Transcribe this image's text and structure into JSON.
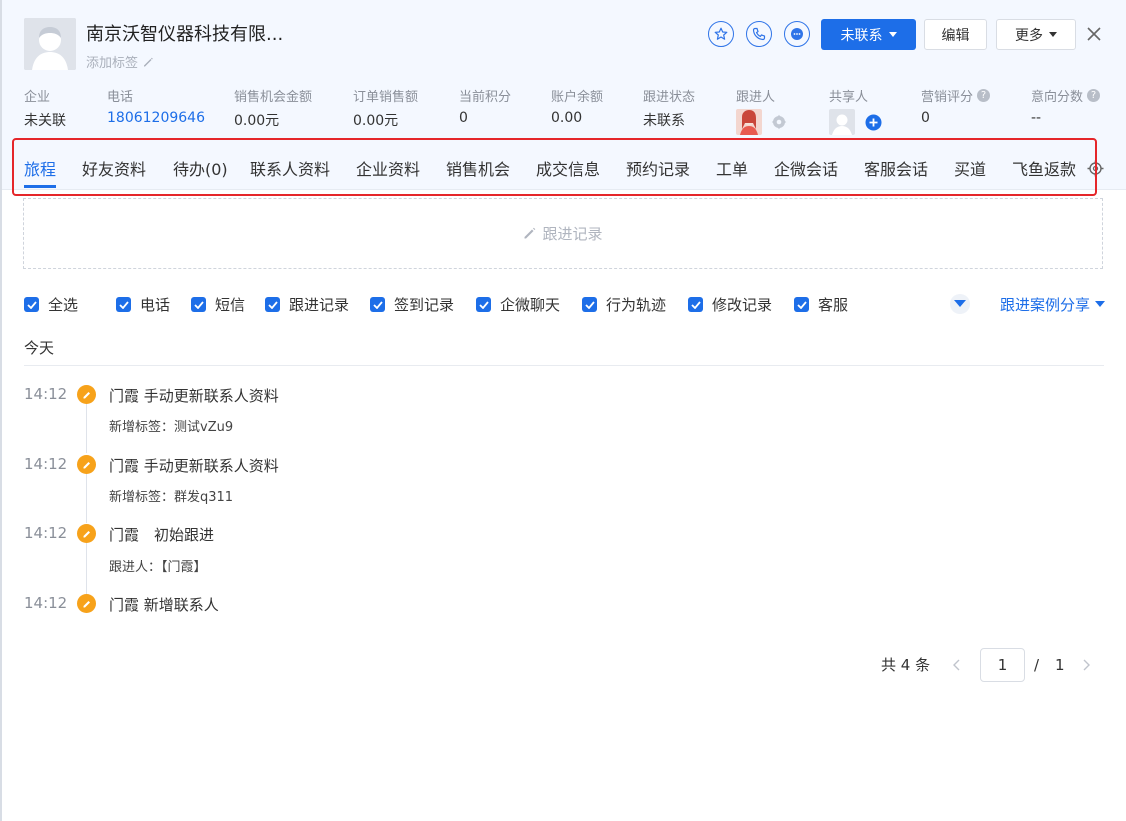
{
  "header": {
    "company_name": "南京沃智仪器科技有限...",
    "add_tag_label": "添加标签",
    "status_button": "未联系",
    "edit_button": "编辑",
    "more_button": "更多"
  },
  "stats": [
    {
      "label": "企业",
      "value": "未关联"
    },
    {
      "label": "电话",
      "value": "18061209646"
    },
    {
      "label": "销售机会金额",
      "value": "0.00元"
    },
    {
      "label": "订单销售额",
      "value": "0.00元"
    },
    {
      "label": "当前积分",
      "value": "0"
    },
    {
      "label": "账户余额",
      "value": "0.00"
    },
    {
      "label": "跟进状态",
      "value": "未联系"
    },
    {
      "label": "跟进人",
      "value": ""
    },
    {
      "label": "共享人",
      "value": ""
    },
    {
      "label": "营销评分",
      "value": "0"
    },
    {
      "label": "意向分数",
      "value": "--"
    }
  ],
  "tabs": [
    "旅程",
    "好友资料",
    "待办(0)",
    "联系人资料",
    "企业资料",
    "销售机会",
    "成交信息",
    "预约记录",
    "工单",
    "企微会话",
    "客服会话",
    "买道",
    "飞鱼返款"
  ],
  "active_tab": "旅程",
  "followup_placeholder": "跟进记录",
  "filters": [
    "全选",
    "电话",
    "短信",
    "跟进记录",
    "签到记录",
    "企微聊天",
    "行为轨迹",
    "修改记录",
    "客服"
  ],
  "share_link": "跟进案例分享",
  "today_label": "今天",
  "timeline": [
    {
      "time": "14:12",
      "title": "门霞 手动更新联系人资料",
      "sub": "新增标签：测试vZu9"
    },
    {
      "time": "14:12",
      "title": "门霞 手动更新联系人资料",
      "sub": "新增标签：群发q311"
    },
    {
      "time": "14:12",
      "title": "门霞　初始跟进",
      "sub": "跟进人：【门霞】"
    },
    {
      "time": "14:12",
      "title": "门霞 新增联系人",
      "sub": ""
    }
  ],
  "pagination": {
    "total_label": "共 4 条",
    "current_page": "1",
    "separator": "/",
    "total_pages": "1"
  },
  "colors": {
    "accent": "#1d6ee8",
    "timeline_dot": "#f7a21a",
    "highlight_box": "#e5262a"
  }
}
